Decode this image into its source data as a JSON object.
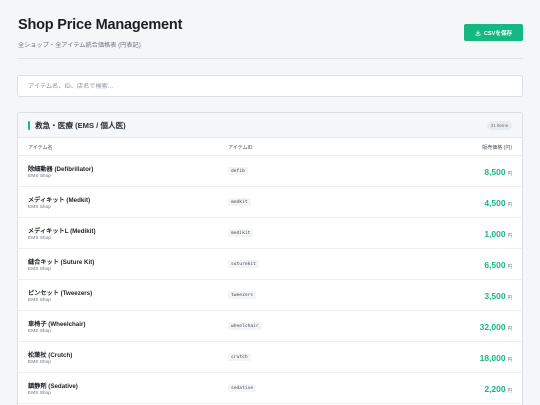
{
  "header": {
    "title": "Shop Price Management",
    "subtitle": "全ショップ・全アイテム統合価格表 (円表記)",
    "csv_button": "CSVを保存"
  },
  "search": {
    "placeholder": "アイテム名、ID、店名で検索..."
  },
  "category": {
    "title": "救急・医療 (EMS / 個人医)",
    "count_badge": "31 items",
    "accent_color": "#14b981"
  },
  "columns": {
    "name": "アイテム名",
    "id": "アイテムID",
    "price": "販売価格 (円)"
  },
  "currency_unit": "円",
  "items": [
    {
      "name": "除細動器 (Defibrillator)",
      "shop": "EMS Shop",
      "id": "defib",
      "price": "8,500"
    },
    {
      "name": "メディキット (Medkit)",
      "shop": "EMS Shop",
      "id": "medkit",
      "price": "4,500"
    },
    {
      "name": "メディキットL (Medikit)",
      "shop": "EMS Shop",
      "id": "medikit",
      "price": "1,000"
    },
    {
      "name": "縫合キット (Suture Kit)",
      "shop": "EMS Shop",
      "id": "suturekit",
      "price": "6,500"
    },
    {
      "name": "ピンセット (Tweezers)",
      "shop": "EMS Shop",
      "id": "tweezers",
      "price": "3,500"
    },
    {
      "name": "車椅子 (Wheelchair)",
      "shop": "EMS Shop",
      "id": "wheelchair",
      "price": "32,000"
    },
    {
      "name": "松葉杖 (Crutch)",
      "shop": "EMS Shop",
      "id": "crutch",
      "price": "18,000"
    },
    {
      "name": "鎮静剤 (Sedative)",
      "shop": "EMS Shop",
      "id": "sedative",
      "price": "2,200"
    }
  ]
}
